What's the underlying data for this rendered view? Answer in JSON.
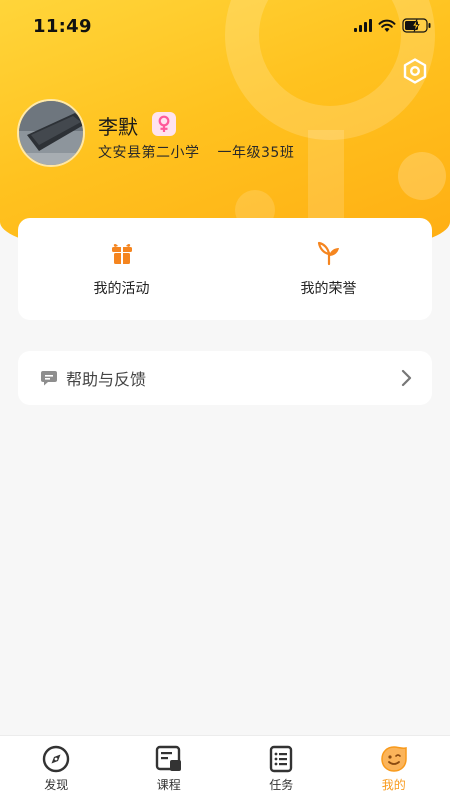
{
  "status_bar": {
    "time": "11:49"
  },
  "profile": {
    "name": "李默",
    "gender_symbol": "♀",
    "school": "文安县第二小学",
    "class": "一年级35班"
  },
  "actions": [
    {
      "label": "我的活动",
      "icon": "gift-icon"
    },
    {
      "label": "我的荣誉",
      "icon": "sprout-icon"
    }
  ],
  "help": {
    "label": "帮助与反馈",
    "icon": "chat-bubble-icon"
  },
  "tabs": [
    {
      "label": "发现",
      "icon": "compass-icon",
      "active": false
    },
    {
      "label": "课程",
      "icon": "course-icon",
      "active": false
    },
    {
      "label": "任务",
      "icon": "task-list-icon",
      "active": false
    },
    {
      "label": "我的",
      "icon": "face-icon",
      "active": true
    }
  ],
  "colors": {
    "accent": "#ffb31a",
    "tab_active": "#f89a1c",
    "icon_orange": "#f5851f",
    "gender": "#ff5a9a"
  }
}
